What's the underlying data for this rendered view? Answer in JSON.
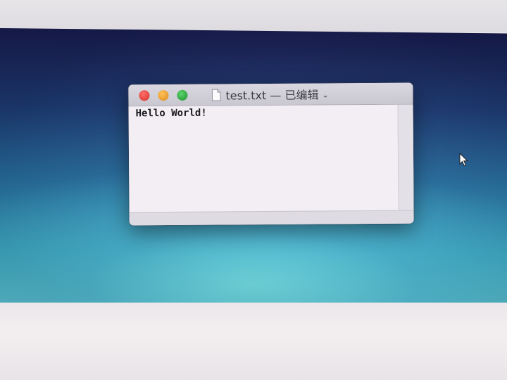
{
  "window": {
    "title": "test.txt — 已编辑",
    "chevron": "⌄",
    "document_text": "Hello World!",
    "file_icon": "document-icon"
  },
  "controls": {
    "close_icon": "close-button",
    "minimize_icon": "minimize-button",
    "zoom_icon": "zoom-button"
  },
  "colors": {
    "close": "#e0443d",
    "minimize": "#e79a2c",
    "zoom": "#2fa441",
    "wallpaper_top": "#1a1e55",
    "wallpaper_bottom": "#67d8e4"
  },
  "cursor": "arrow-cursor-icon"
}
